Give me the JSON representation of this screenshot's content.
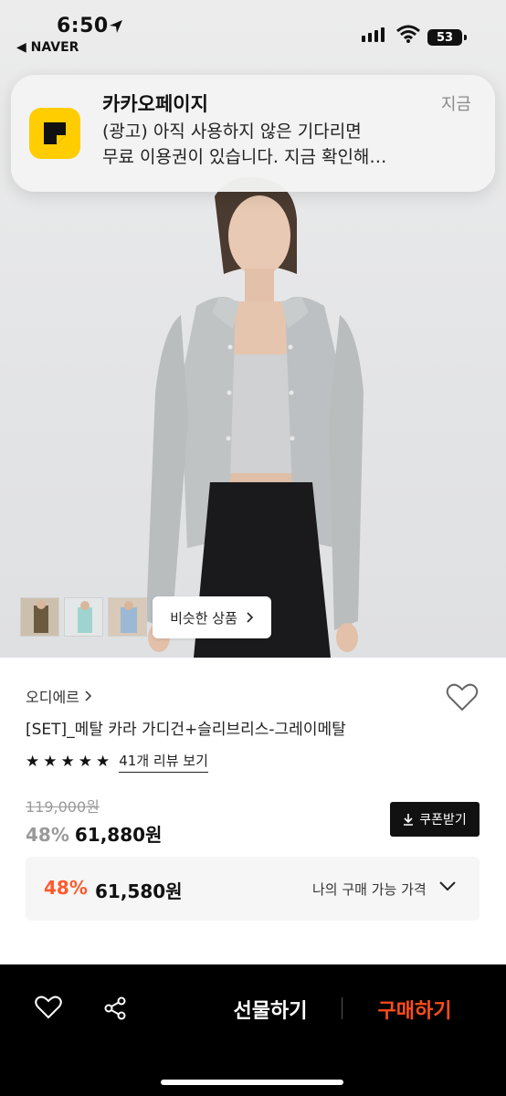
{
  "status_bar": {
    "time": "6:50",
    "back_app": "◀ NAVER",
    "battery": "53"
  },
  "notification": {
    "app_name": "카카오페이지",
    "time": "지금",
    "line1": "(광고) 아직 사용하지 않은 기다리면",
    "line2": "무료 이용권이 있습니다. 지금 확인해…"
  },
  "gallery": {
    "thumbnails": [
      "brown-outfit-thumbnail",
      "mint-outfit-thumbnail",
      "blue-outfit-thumbnail"
    ],
    "similar_button": "비슷한 상품"
  },
  "product": {
    "brand": "오디에르",
    "title": "[SET]_메탈 카라 가디건+슬리브리스-그레이메탈",
    "rating_stars": 5,
    "review_link": "41개 리뷰 보기",
    "original_price": "119,000원",
    "discount_pct": "48%",
    "sale_price": "61,880원",
    "coupon_button": "쿠폰받기"
  },
  "my_price": {
    "discount_pct": "48%",
    "price": "61,580원",
    "label": "나의 구매 가능 가격"
  },
  "bottom_bar": {
    "gift_button": "선물하기",
    "buy_button": "구매하기"
  },
  "colors": {
    "accent_orange": "#ff5a2d",
    "buy_orange": "#ff4d1a",
    "kakaopage_yellow": "#ffcd00"
  }
}
